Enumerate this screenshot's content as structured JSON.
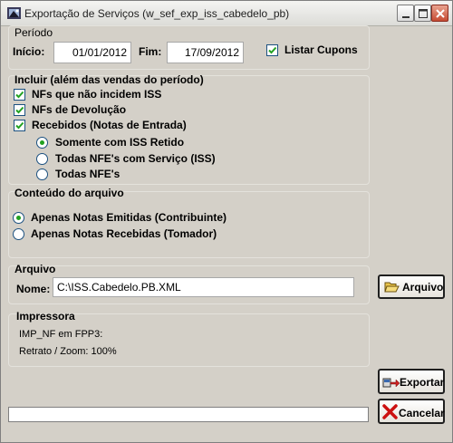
{
  "window": {
    "title": "Exportação de Serviços (w_sef_exp_iss_cabedelo_pb)"
  },
  "periodo": {
    "group_title": "Período",
    "inicio_label": "Início:",
    "inicio_value": "01/01/2012",
    "fim_label": "Fim:",
    "fim_value": "17/09/2012",
    "listar_cupons_label": "Listar Cupons",
    "listar_cupons_checked": true
  },
  "incluir": {
    "group_title": "Incluir (além das vendas do período)",
    "options": [
      {
        "label": "NFs que não incidem ISS",
        "checked": true
      },
      {
        "label": "NFs de Devolução",
        "checked": true
      },
      {
        "label": "Recebidos (Notas de Entrada)",
        "checked": true
      }
    ],
    "recebidos_radios": [
      {
        "label": "Somente com ISS Retido",
        "selected": true
      },
      {
        "label": "Todas NFE's com Serviço (ISS)",
        "selected": false
      },
      {
        "label": "Todas NFE's",
        "selected": false
      }
    ]
  },
  "conteudo": {
    "group_title": "Conteúdo do arquivo",
    "radios": [
      {
        "label": "Apenas Notas Emitidas (Contribuinte)",
        "selected": true
      },
      {
        "label": "Apenas Notas Recebidas (Tomador)",
        "selected": false
      }
    ]
  },
  "arquivo": {
    "group_title": "Arquivo",
    "nome_label": "Nome:",
    "nome_value": "C:\\ISS.Cabedelo.PB.XML",
    "button_label": "Arquivo"
  },
  "impressora": {
    "group_title": "Impressora",
    "printer_line": "IMP_NF em FPP3:",
    "zoom_line": "Retrato / Zoom: 100%"
  },
  "actions": {
    "exportar_label": "Exportar",
    "cancelar_label": "Cancelar"
  },
  "progress": {
    "value": 0
  },
  "colors": {
    "check": "#21a121",
    "cancel_x": "#cc1010"
  }
}
